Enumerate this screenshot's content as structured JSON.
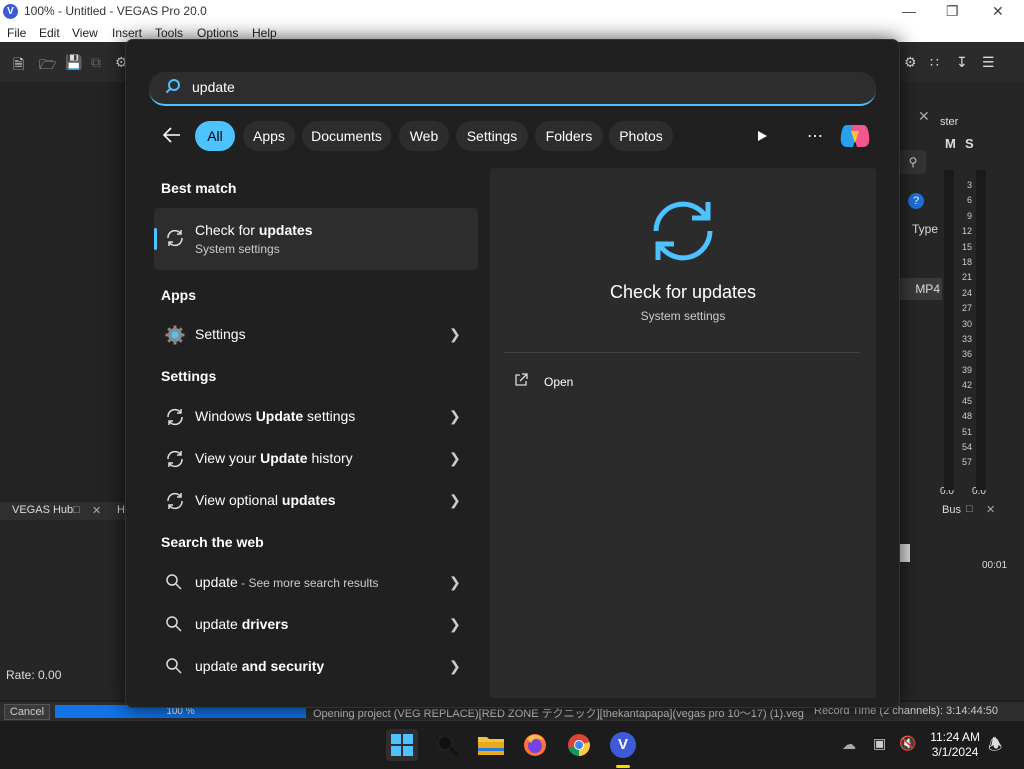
{
  "window": {
    "logo": "V",
    "title": "100% - Untitled - VEGAS Pro 20.0",
    "menu": [
      "File",
      "Edit",
      "View",
      "Insert",
      "Tools",
      "Options",
      "Help"
    ]
  },
  "vegas_right": {
    "master_label": "ster",
    "m": "M",
    "s": "S",
    "type_label": "Type",
    "format": "MP4",
    "db_scale": [
      "3",
      "6",
      "9",
      "12",
      "15",
      "18",
      "21",
      "24",
      "27",
      "30",
      "33",
      "36",
      "39",
      "42",
      "45",
      "48",
      "51",
      "54",
      "57"
    ],
    "meter_left": "0.0",
    "meter_right": "0.0",
    "bus_label": "Bus",
    "time_label": "00:01"
  },
  "vegas_left": {
    "hub_tab": "VEGAS Hub",
    "second_tab": "H",
    "rate": "Rate: 0.00"
  },
  "status": {
    "cancel": "Cancel",
    "progress_text": "100 %",
    "progress": 1.0,
    "message": "Opening project (VEG REPLACE)[RED ZONE テクニック][thekantapapa](vegas pro 10～17) (1).veg",
    "record_time": "Record Time (2 channels): 3:14:44:50"
  },
  "search": {
    "query": "update",
    "filters": [
      "All",
      "Apps",
      "Documents",
      "Web",
      "Settings",
      "Folders",
      "Photos"
    ],
    "active_filter": "All"
  },
  "results": {
    "best_match_heading": "Best match",
    "best": {
      "title_plain": "Check for ",
      "title_bold": "updates",
      "subtitle": "System settings"
    },
    "apps_heading": "Apps",
    "apps": [
      {
        "label": "Settings"
      }
    ],
    "settings_heading": "Settings",
    "settings": [
      {
        "pre": "Windows ",
        "bold": "Update",
        "post": " settings"
      },
      {
        "pre": "View your ",
        "bold": "Update",
        "post": " history"
      },
      {
        "pre": "View optional ",
        "bold": "updates",
        "post": ""
      }
    ],
    "web_heading": "Search the web",
    "web": [
      {
        "pre": "update",
        "bold": "",
        "post": " - See more search results"
      },
      {
        "pre": "update ",
        "bold": "drivers",
        "post": ""
      },
      {
        "pre": "update ",
        "bold": "and security",
        "post": ""
      }
    ]
  },
  "detail": {
    "title": "Check for updates",
    "subtitle": "System settings",
    "action": "Open"
  },
  "taskbar": {
    "time": "11:24 AM",
    "date": "3/1/2024",
    "v_logo": "V"
  },
  "colors": {
    "accent": "#4cc2ff",
    "progress": "#1173e6",
    "vegas_blue": "#3d5bd6"
  }
}
